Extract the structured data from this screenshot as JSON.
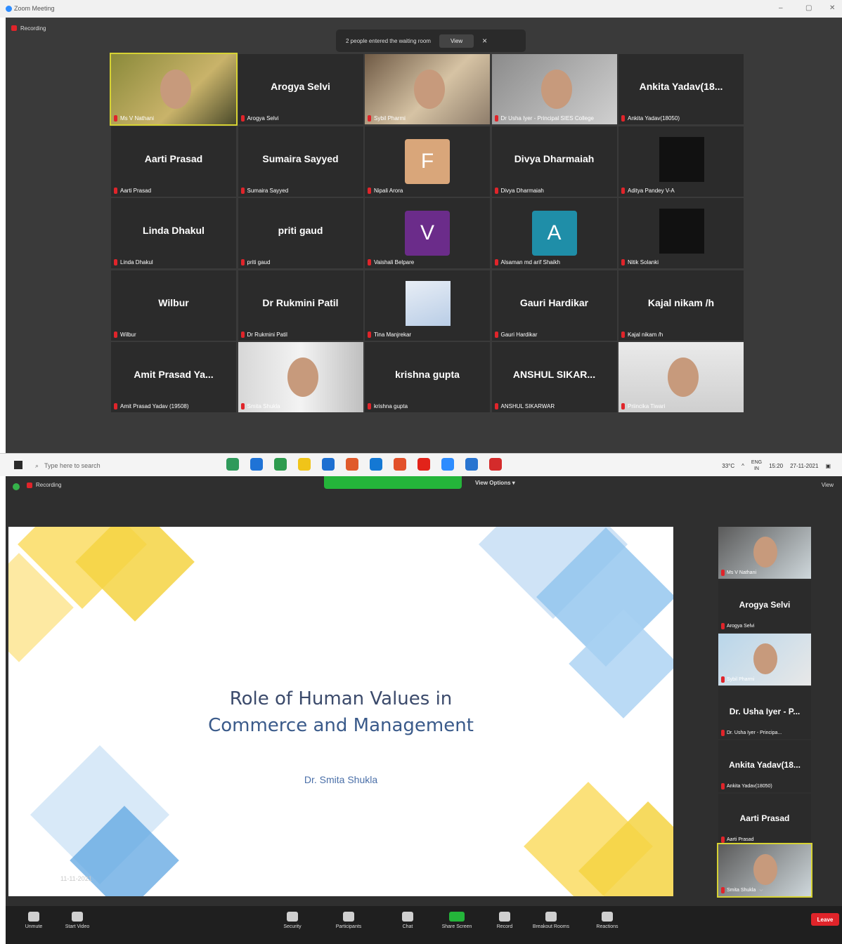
{
  "top_window": {
    "title": "Zoom Meeting",
    "recording_label": "Recording",
    "notice_text": "2 people entered the waiting room",
    "notice_view": "View",
    "notice_close": "×"
  },
  "tiles": [
    {
      "display": "",
      "label": "Ms V Nathani",
      "kind": "video"
    },
    {
      "display": "Arogya Selvi",
      "label": "Arogya Selvi",
      "kind": "name"
    },
    {
      "display": "",
      "label": "Sybil Pharmi",
      "kind": "video"
    },
    {
      "display": "",
      "label": "Dr Usha Iyer - Principal SIES College",
      "kind": "video"
    },
    {
      "display": "Ankita Yadav(18...",
      "label": "Ankita Yadav(18050)",
      "kind": "name"
    },
    {
      "display": "Aarti Prasad",
      "label": "Aarti Prasad",
      "kind": "name"
    },
    {
      "display": "Sumaira Sayyed",
      "label": "Sumaira Sayyed",
      "kind": "name"
    },
    {
      "display": "F",
      "label": "Nipali Arora",
      "kind": "avatar",
      "color": "#d9a67a"
    },
    {
      "display": "Divya Dharmaiah",
      "label": "Divya Dharmaiah",
      "kind": "name"
    },
    {
      "display": "",
      "label": "Aditya Pandey V-A",
      "kind": "black"
    },
    {
      "display": "Linda Dhakul",
      "label": "Linda Dhakul",
      "kind": "name"
    },
    {
      "display": "priti gaud",
      "label": "priti gaud",
      "kind": "name"
    },
    {
      "display": "V",
      "label": "Vaishali Belpare",
      "kind": "avatar",
      "color": "#6b2c8a"
    },
    {
      "display": "A",
      "label": "Alsaman md arif Shaikh",
      "kind": "avatar",
      "color": "#1f8ea8"
    },
    {
      "display": "",
      "label": "Nitik Solanki",
      "kind": "black"
    },
    {
      "display": "Wilbur",
      "label": "Wilbur",
      "kind": "name"
    },
    {
      "display": "Dr Rukmini Patil",
      "label": "Dr Rukmini Patil",
      "kind": "name"
    },
    {
      "display": "",
      "label": "Tina Manjrekar",
      "kind": "image"
    },
    {
      "display": "Gauri Hardikar",
      "label": "Gauri Hardikar",
      "kind": "name"
    },
    {
      "display": "Kajal nikam /h",
      "label": "Kajal nikam /h",
      "kind": "name"
    },
    {
      "display": "Amit Prasad Ya...",
      "label": "Amit Prasad Yadav (19508)",
      "kind": "name"
    },
    {
      "display": "",
      "label": "Smita Shukla",
      "kind": "video"
    },
    {
      "display": "krishna gupta",
      "label": "krishna gupta",
      "kind": "name"
    },
    {
      "display": "ANSHUL SIKAR...",
      "label": "ANSHUL SIKARWAR",
      "kind": "name"
    },
    {
      "display": "",
      "label": "Priincika Tiwari",
      "kind": "video"
    }
  ],
  "taskbar": {
    "search_placeholder": "Type here to search",
    "temp": "33°C",
    "lang": "ENG\nIN",
    "time": "15:20",
    "date": "27-11-2021"
  },
  "bottom_window": {
    "recording_label": "Recording",
    "view_options": "View Options ▾",
    "view_right": "View",
    "slide": {
      "title_line1": "Role of Human Values in",
      "title_line2": "Commerce and Management",
      "author": "Dr. Smita Shukla",
      "date": "11-11-2021"
    },
    "strip": [
      {
        "display": "",
        "label": "Ms V Nathani",
        "kind": "video"
      },
      {
        "display": "Arogya Selvi",
        "label": "Arogya Selvi",
        "kind": "name"
      },
      {
        "display": "",
        "label": "Sybil Pharmi",
        "kind": "video"
      },
      {
        "display": "Dr. Usha Iyer - P...",
        "label": "Dr. Usha Iyer - Principa...",
        "kind": "name"
      },
      {
        "display": "Ankita Yadav(18...",
        "label": "Ankita Yadav(18050)",
        "kind": "name"
      },
      {
        "display": "Aarti Prasad",
        "label": "Aarti Prasad",
        "kind": "name"
      },
      {
        "display": "",
        "label": "Smita Shukla",
        "kind": "video"
      }
    ],
    "toolbar": [
      {
        "label": "Unmute"
      },
      {
        "label": "Start Video"
      },
      {
        "label": "Security"
      },
      {
        "label": "Participants"
      },
      {
        "label": "Chat"
      },
      {
        "label": "Share Screen"
      },
      {
        "label": "Record"
      },
      {
        "label": "Breakout Rooms"
      },
      {
        "label": "Reactions"
      }
    ],
    "leave": "Leave"
  }
}
